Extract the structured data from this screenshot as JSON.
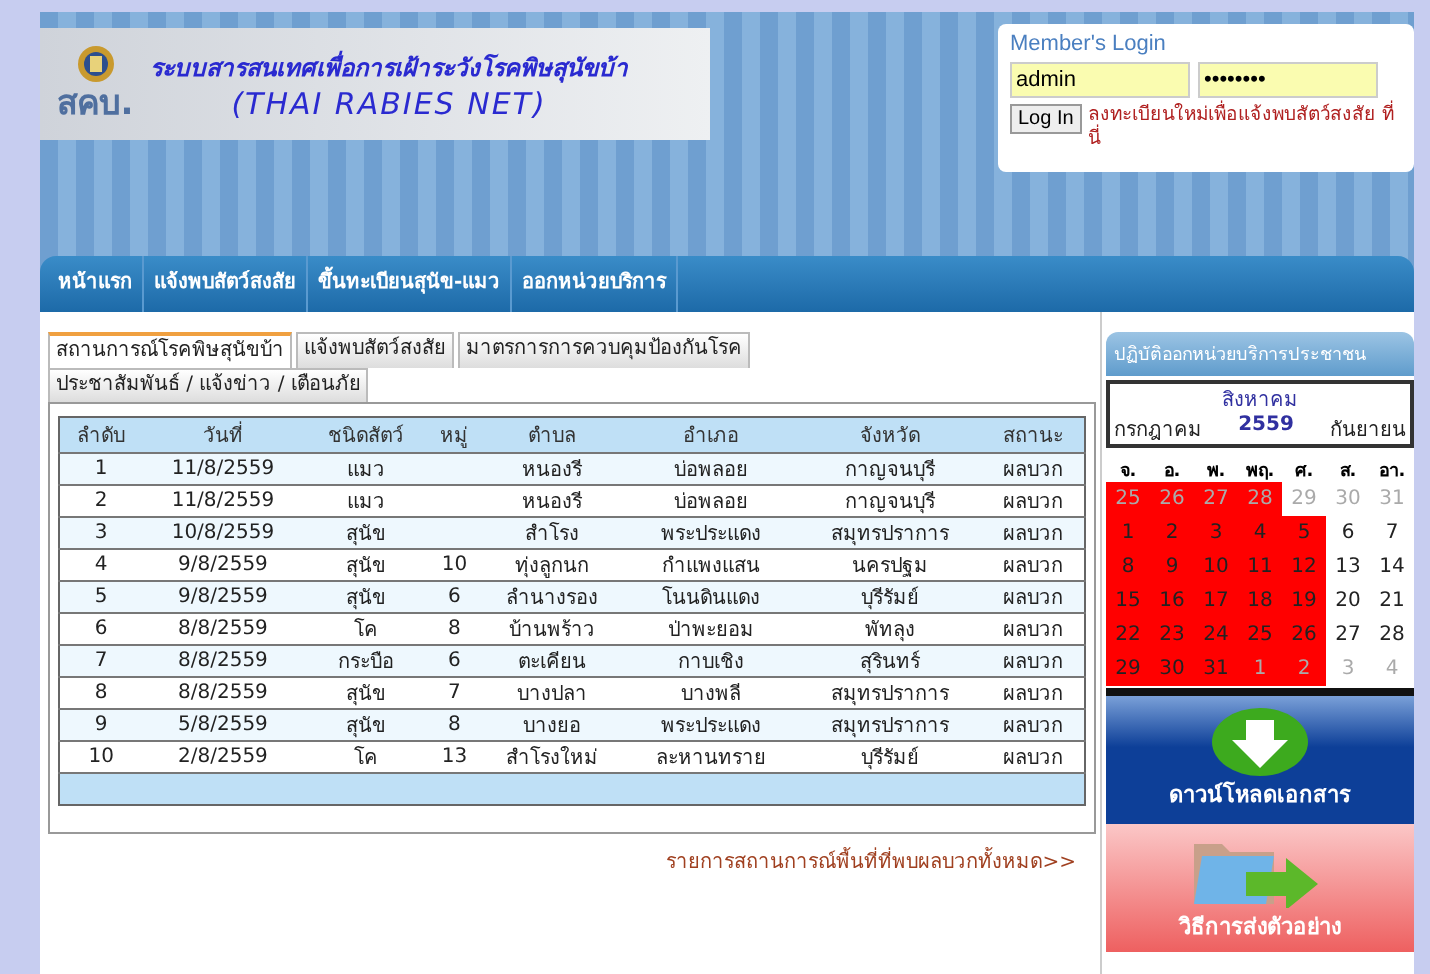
{
  "header": {
    "title": "ระบบสารสนเทศเพื่อการเฝ้าระวังโรคพิษสุนัขบ้า",
    "subtitle": "(THAI RABIES NET)",
    "logo_text": "สคบ."
  },
  "login": {
    "title": "Member's Login",
    "username": "admin",
    "password": "••••••••",
    "button": "Log In",
    "register_link": "ลงทะเบียนใหม่เพื่อแจ้งพบสัตว์สงสัย ที่นี่"
  },
  "nav": [
    "หน้าแรก",
    "แจ้งพบสัตว์สงสัย",
    "ขึ้นทะเบียนสุนัข-แมว",
    "ออกหน่วยบริการ"
  ],
  "tabs": [
    {
      "label": "สถานการณ์โรคพิษสุนัขบ้า",
      "selected": true
    },
    {
      "label": "แจ้งพบสัตว์สงสัย",
      "selected": false
    },
    {
      "label": "มาตรการการควบคุมป้องกันโรค",
      "selected": false
    },
    {
      "label": "ประชาสัมพันธ์ / แจ้งข่าว / เตือนภัย",
      "selected": false
    }
  ],
  "table": {
    "columns": [
      "ลำดับ",
      "วันที่",
      "ชนิดสัตว์",
      "หมู่",
      "ตำบล",
      "อำเภอ",
      "จังหวัด",
      "สถานะ"
    ],
    "rows": [
      [
        "1",
        "11/8/2559",
        "แมว",
        "",
        "หนองรี",
        "บ่อพลอย",
        "กาญจนบุรี",
        "ผลบวก"
      ],
      [
        "2",
        "11/8/2559",
        "แมว",
        "",
        "หนองรี",
        "บ่อพลอย",
        "กาญจนบุรี",
        "ผลบวก"
      ],
      [
        "3",
        "10/8/2559",
        "สุนัข",
        "",
        "สำโรง",
        "พระประแดง",
        "สมุทรปราการ",
        "ผลบวก"
      ],
      [
        "4",
        "9/8/2559",
        "สุนัข",
        "10",
        "ทุ่งลูกนก",
        "กำแพงแสน",
        "นครปฐม",
        "ผลบวก"
      ],
      [
        "5",
        "9/8/2559",
        "สุนัข",
        "6",
        "ลำนางรอง",
        "โนนดินแดง",
        "บุรีรัมย์",
        "ผลบวก"
      ],
      [
        "6",
        "8/8/2559",
        "โค",
        "8",
        "บ้านพร้าว",
        "ป่าพะยอม",
        "พัทลุง",
        "ผลบวก"
      ],
      [
        "7",
        "8/8/2559",
        "กระบือ",
        "6",
        "ตะเคียน",
        "กาบเชิง",
        "สุรินทร์",
        "ผลบวก"
      ],
      [
        "8",
        "8/8/2559",
        "สุนัข",
        "7",
        "บางปลา",
        "บางพลี",
        "สมุทรปราการ",
        "ผลบวก"
      ],
      [
        "9",
        "5/8/2559",
        "สุนัข",
        "8",
        "บางยอ",
        "พระประแดง",
        "สมุทรปราการ",
        "ผลบวก"
      ],
      [
        "10",
        "2/8/2559",
        "โค",
        "13",
        "สำโรงใหม่",
        "ละหานทราย",
        "บุรีรัมย์",
        "ผลบวก"
      ]
    ]
  },
  "more_link": "รายการสถานการณ์พื้นที่ที่พบผลบวกทั้งหมด>>",
  "sidebar": {
    "title": "ปฏิบัติออกหน่วยบริการประชาชน",
    "calendar": {
      "month": "สิงหาคม",
      "prev": "กรกฎาคม",
      "year": "2559",
      "next": "กันยายน",
      "weekdays": [
        "จ.",
        "อ.",
        "พ.",
        "พฤ.",
        "ศ.",
        "ส.",
        "อา."
      ],
      "weeks": [
        [
          {
            "day": "25",
            "outside": true,
            "marked": true
          },
          {
            "day": "26",
            "outside": true,
            "marked": true
          },
          {
            "day": "27",
            "outside": true,
            "marked": true
          },
          {
            "day": "28",
            "outside": true,
            "marked": true
          },
          {
            "day": "29",
            "outside": true,
            "marked": false
          },
          {
            "day": "30",
            "outside": true,
            "marked": false
          },
          {
            "day": "31",
            "outside": true,
            "marked": false
          }
        ],
        [
          {
            "day": "1",
            "outside": false,
            "marked": true
          },
          {
            "day": "2",
            "outside": false,
            "marked": true
          },
          {
            "day": "3",
            "outside": false,
            "marked": true
          },
          {
            "day": "4",
            "outside": false,
            "marked": true
          },
          {
            "day": "5",
            "outside": false,
            "marked": true
          },
          {
            "day": "6",
            "outside": false,
            "marked": false
          },
          {
            "day": "7",
            "outside": false,
            "marked": false
          }
        ],
        [
          {
            "day": "8",
            "outside": false,
            "marked": true
          },
          {
            "day": "9",
            "outside": false,
            "marked": true
          },
          {
            "day": "10",
            "outside": false,
            "marked": true
          },
          {
            "day": "11",
            "outside": false,
            "marked": true
          },
          {
            "day": "12",
            "outside": false,
            "marked": true
          },
          {
            "day": "13",
            "outside": false,
            "marked": false
          },
          {
            "day": "14",
            "outside": false,
            "marked": false
          }
        ],
        [
          {
            "day": "15",
            "outside": false,
            "marked": true
          },
          {
            "day": "16",
            "outside": false,
            "marked": true
          },
          {
            "day": "17",
            "outside": false,
            "marked": true
          },
          {
            "day": "18",
            "outside": false,
            "marked": true
          },
          {
            "day": "19",
            "outside": false,
            "marked": true
          },
          {
            "day": "20",
            "outside": false,
            "marked": false
          },
          {
            "day": "21",
            "outside": false,
            "marked": false
          }
        ],
        [
          {
            "day": "22",
            "outside": false,
            "marked": true
          },
          {
            "day": "23",
            "outside": false,
            "marked": true
          },
          {
            "day": "24",
            "outside": false,
            "marked": true
          },
          {
            "day": "25",
            "outside": false,
            "marked": true
          },
          {
            "day": "26",
            "outside": false,
            "marked": true
          },
          {
            "day": "27",
            "outside": false,
            "marked": false
          },
          {
            "day": "28",
            "outside": false,
            "marked": false
          }
        ],
        [
          {
            "day": "29",
            "outside": false,
            "marked": true
          },
          {
            "day": "30",
            "outside": false,
            "marked": true
          },
          {
            "day": "31",
            "outside": false,
            "marked": true
          },
          {
            "day": "1",
            "outside": true,
            "marked": true
          },
          {
            "day": "2",
            "outside": true,
            "marked": true
          },
          {
            "day": "3",
            "outside": true,
            "marked": false
          },
          {
            "day": "4",
            "outside": true,
            "marked": false
          }
        ]
      ]
    },
    "banners": [
      {
        "kind": "download",
        "label": "ดาวน์โหลดเอกสาร"
      },
      {
        "kind": "send",
        "label": "วิธีการส่งตัวอย่าง"
      }
    ]
  }
}
